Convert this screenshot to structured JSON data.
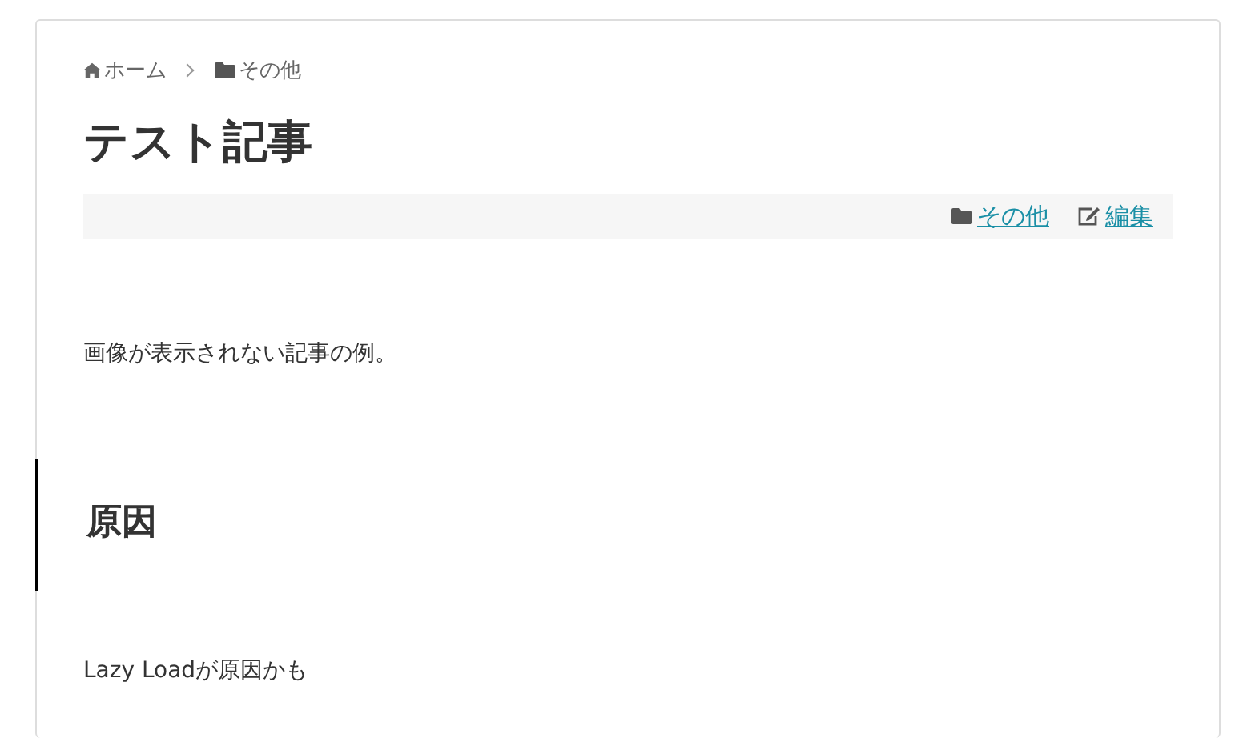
{
  "breadcrumb": [
    {
      "label": "ホーム",
      "kind": "home"
    },
    {
      "label": "その他",
      "kind": "category"
    }
  ],
  "title": "テスト記事",
  "meta": [
    {
      "label": "その他",
      "kind": "category"
    },
    {
      "label": "編集",
      "kind": "edit"
    }
  ],
  "body": [
    {
      "kind": "paragraph",
      "text": "画像が表示されない記事の例。"
    },
    {
      "kind": "heading",
      "text": "原因"
    },
    {
      "kind": "paragraph",
      "text": "Lazy Loadが原因かも"
    }
  ]
}
